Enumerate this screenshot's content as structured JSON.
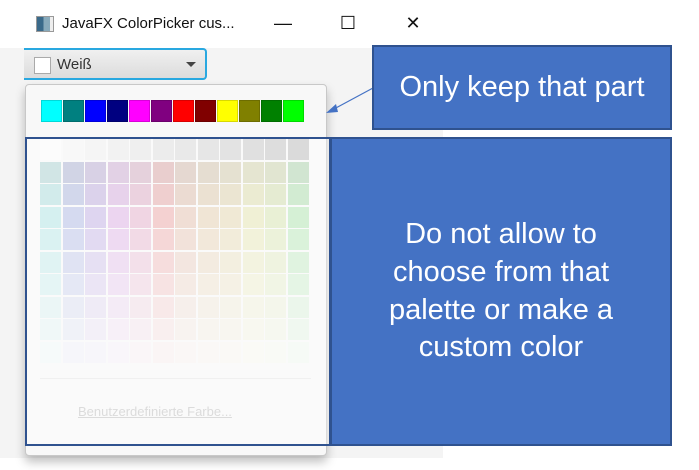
{
  "window": {
    "title": "JavaFX ColorPicker cus...",
    "minimize_label": "—",
    "maximize_label": "☐",
    "close_label": "✕"
  },
  "combo": {
    "selected_label": "Weiß",
    "selected_color": "#ffffff"
  },
  "popup": {
    "custom_colors": [
      "#00ffff",
      "#008080",
      "#0000ff",
      "#000080",
      "#ff00ff",
      "#800080",
      "#ff0000",
      "#800000",
      "#ffff00",
      "#808000",
      "#008000",
      "#00ff00"
    ],
    "custom_color_link": "Benutzerdefinierte Farbe..."
  },
  "annotations": {
    "keep": "Only keep that part",
    "disallow": "Do not allow to choose from that palette or make a custom color",
    "accent": "#4472c4"
  }
}
